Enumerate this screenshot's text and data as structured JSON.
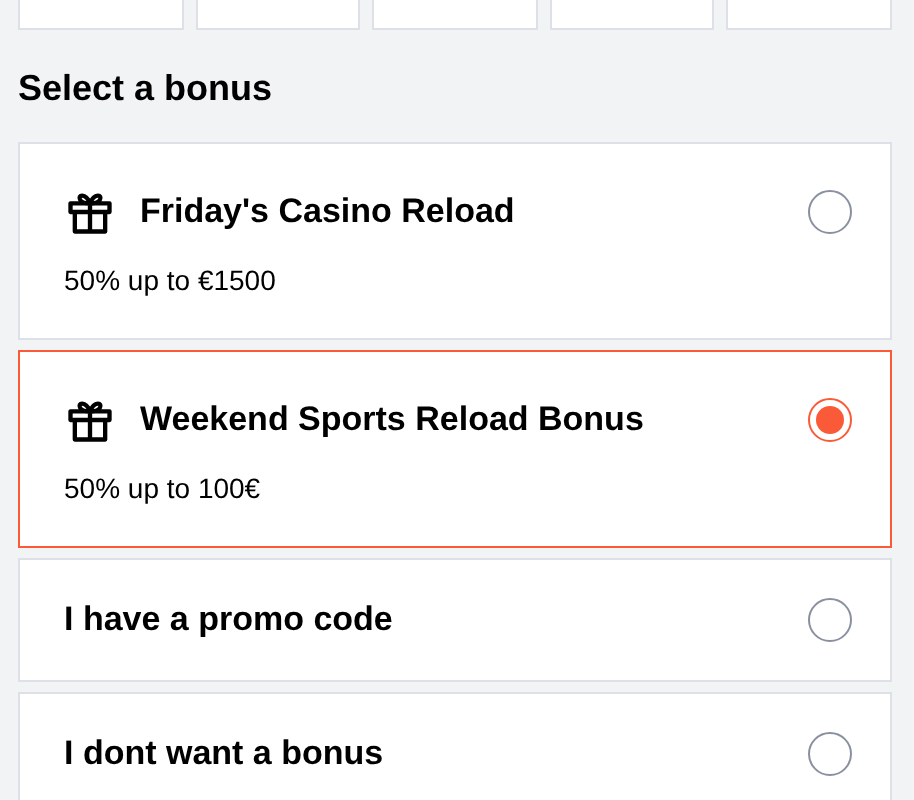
{
  "top_tiles": [
    {
      "kind": "tile"
    },
    {
      "kind": "tile"
    },
    {
      "kind": "tile"
    },
    {
      "kind": "tile"
    },
    {
      "kind": "tile"
    }
  ],
  "heading": "Select a bonus",
  "bonuses": [
    {
      "kind": "gift",
      "title": "Friday's Casino Reload",
      "subtitle": "50% up to €1500",
      "selected": false
    },
    {
      "kind": "gift",
      "title": "Weekend Sports Reload Bonus",
      "subtitle": "50% up to 100€",
      "selected": true
    },
    {
      "kind": "plain",
      "title": "I have a promo code",
      "selected": false
    },
    {
      "kind": "plain",
      "title": "I dont want a bonus",
      "selected": false
    }
  ]
}
